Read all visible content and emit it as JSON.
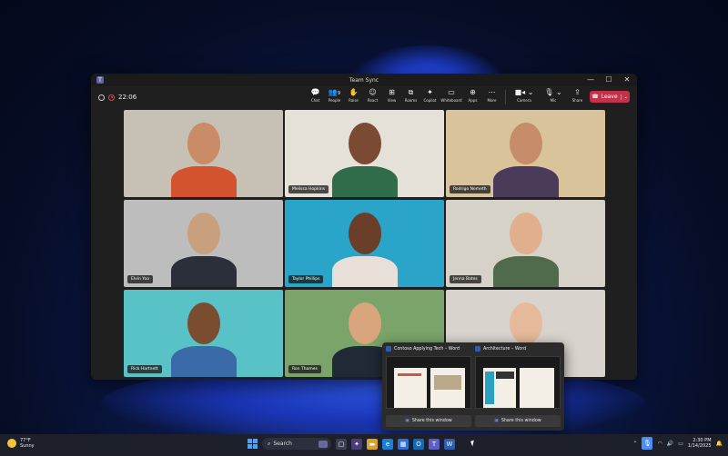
{
  "window": {
    "title": "Team Sync",
    "controls": [
      "—",
      "☐",
      "✕"
    ]
  },
  "meeting": {
    "timer": "22:06",
    "toolbar": [
      {
        "label": "Chat",
        "icon": "💬"
      },
      {
        "label": "People",
        "icon": "👥",
        "badge": "9"
      },
      {
        "label": "Raise",
        "icon": "✋"
      },
      {
        "label": "React",
        "icon": "☺"
      },
      {
        "label": "View",
        "icon": "⊞"
      },
      {
        "label": "Rooms",
        "icon": "⧉"
      },
      {
        "label": "Copilot",
        "icon": "✦"
      },
      {
        "label": "Whiteboard",
        "icon": "▭"
      },
      {
        "label": "Apps",
        "icon": "⊕"
      },
      {
        "label": "More",
        "icon": "⋯"
      }
    ],
    "camera_label": "Camera",
    "mic_label": "Mic",
    "share_label": "Share",
    "leave_label": "Leave"
  },
  "participants": [
    {
      "name": "",
      "bg": "#c7c0b4",
      "skin": "#c98c66",
      "shirt": "#d2532e"
    },
    {
      "name": "Melissa Hopkins",
      "bg": "#e6e1d8",
      "skin": "#7a4a32",
      "shirt": "#2f6d4a"
    },
    {
      "name": "Rodrigo Nemeth",
      "bg": "#d9c39a",
      "skin": "#c78c6a",
      "shirt": "#4a3b5a"
    },
    {
      "name": "Elvin Yoo",
      "bg": "#bdbdbd",
      "skin": "#c9a07e",
      "shirt": "#2b2f3a"
    },
    {
      "name": "Taylor Phillips",
      "bg": "#2aa5c9",
      "skin": "#6a3e28",
      "shirt": "#e8e0d8"
    },
    {
      "name": "Jenna Bates",
      "bg": "#d7d2c8",
      "skin": "#e0b08e",
      "shirt": "#4f6b4c"
    },
    {
      "name": "Rick Hartnett",
      "bg": "#58c2c6",
      "skin": "#7a4c30",
      "shirt": "#3a6aa8"
    },
    {
      "name": "Ron Thames",
      "bg": "#7aa46a",
      "skin": "#d9a57c",
      "shirt": "#1f2a36"
    },
    {
      "name": "",
      "bg": "#d8d3cc",
      "skin": "#e5b999",
      "shirt": "#2a2a2a"
    }
  ],
  "popup": {
    "windows": [
      {
        "title": "Contoso Applying Tech – Word",
        "share_label": "Share this window"
      },
      {
        "title": "Architecture – Word",
        "share_label": "Share this window"
      }
    ]
  },
  "taskbar": {
    "weather_temp": "77°F",
    "weather_desc": "Sunny",
    "search_label": "Search",
    "time": "2:30 PM",
    "date": "1/14/2025"
  }
}
